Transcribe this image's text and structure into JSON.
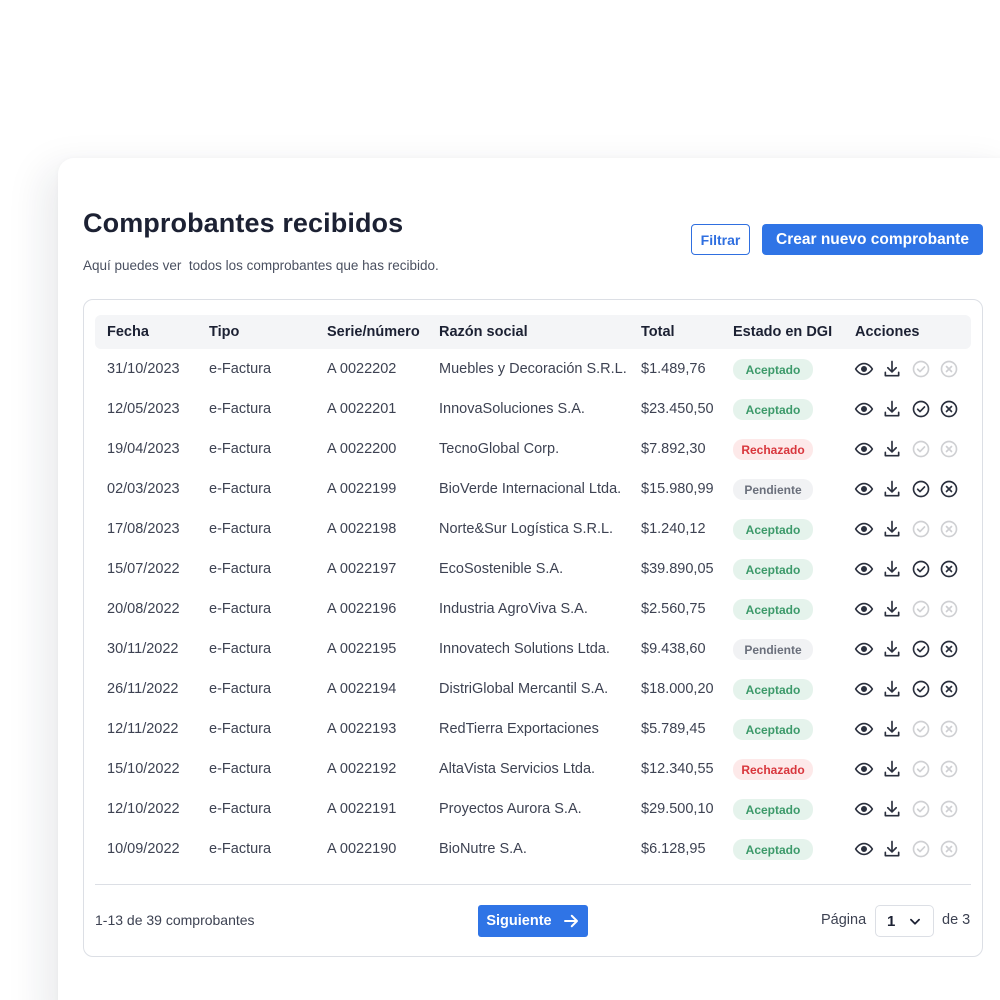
{
  "header": {
    "title": "Comprobantes recibidos",
    "subtitle": "Aquí puedes ver  todos los comprobantes que has recibido.",
    "filter_label": "Filtrar",
    "create_label": "Crear nuevo comprobante"
  },
  "table": {
    "columns": [
      "Fecha",
      "Tipo",
      "Serie/número",
      "Razón social",
      "Total",
      "Estado en DGI",
      "Acciones"
    ],
    "rows": [
      {
        "fecha": "31/10/2023",
        "tipo": "e-Factura",
        "serie": "A 0022202",
        "razon": "Muebles y Decoración S.R.L.",
        "total": "$1.489,76",
        "estado": "Aceptado",
        "estado_type": "ok",
        "actions_enabled": false
      },
      {
        "fecha": "12/05/2023",
        "tipo": "e-Factura",
        "serie": "A 0022201",
        "razon": "InnovaSoluciones S.A.",
        "total": "$23.450,50",
        "estado": "Aceptado",
        "estado_type": "ok",
        "actions_enabled": true
      },
      {
        "fecha": "19/04/2023",
        "tipo": "e-Factura",
        "serie": "A 0022200",
        "razon": "TecnoGlobal Corp.",
        "total": "$7.892,30",
        "estado": "Rechazado",
        "estado_type": "bad",
        "actions_enabled": false
      },
      {
        "fecha": "02/03/2023",
        "tipo": "e-Factura",
        "serie": "A 0022199",
        "razon": "BioVerde Internacional Ltda.",
        "total": "$15.980,99",
        "estado": "Pendiente",
        "estado_type": "pend",
        "actions_enabled": true
      },
      {
        "fecha": "17/08/2023",
        "tipo": "e-Factura",
        "serie": "A 0022198",
        "razon": "Norte&Sur Logística S.R.L.",
        "total": "$1.240,12",
        "estado": "Aceptado",
        "estado_type": "ok",
        "actions_enabled": false
      },
      {
        "fecha": "15/07/2022",
        "tipo": "e-Factura",
        "serie": "A 0022197",
        "razon": "EcoSostenible S.A.",
        "total": "$39.890,05",
        "estado": "Aceptado",
        "estado_type": "ok",
        "actions_enabled": true
      },
      {
        "fecha": "20/08/2022",
        "tipo": "e-Factura",
        "serie": "A 0022196",
        "razon": "Industria AgroViva S.A.",
        "total": "$2.560,75",
        "estado": "Aceptado",
        "estado_type": "ok",
        "actions_enabled": false
      },
      {
        "fecha": "30/11/2022",
        "tipo": "e-Factura",
        "serie": "A 0022195",
        "razon": "Innovatech Solutions Ltda.",
        "total": "$9.438,60",
        "estado": "Pendiente",
        "estado_type": "pend",
        "actions_enabled": true
      },
      {
        "fecha": "26/11/2022",
        "tipo": "e-Factura",
        "serie": "A 0022194",
        "razon": "DistriGlobal Mercantil S.A.",
        "total": "$18.000,20",
        "estado": "Aceptado",
        "estado_type": "ok",
        "actions_enabled": true
      },
      {
        "fecha": "12/11/2022",
        "tipo": "e-Factura",
        "serie": "A 0022193",
        "razon": "RedTierra Exportaciones",
        "total": "$5.789,45",
        "estado": "Aceptado",
        "estado_type": "ok",
        "actions_enabled": false
      },
      {
        "fecha": "15/10/2022",
        "tipo": "e-Factura",
        "serie": "A 0022192",
        "razon": "AltaVista Servicios Ltda.",
        "total": "$12.340,55",
        "estado": "Rechazado",
        "estado_type": "bad",
        "actions_enabled": false
      },
      {
        "fecha": "12/10/2022",
        "tipo": "e-Factura",
        "serie": "A 0022191",
        "razon": "Proyectos Aurora S.A.",
        "total": "$29.500,10",
        "estado": "Aceptado",
        "estado_type": "ok",
        "actions_enabled": false
      },
      {
        "fecha": "10/09/2022",
        "tipo": "e-Factura",
        "serie": "A 0022190",
        "razon": "BioNutre S.A.",
        "total": "$6.128,95",
        "estado": "Aceptado",
        "estado_type": "ok",
        "actions_enabled": false
      }
    ],
    "action_icons": [
      "eye-icon",
      "download-icon",
      "check-circle-icon",
      "x-circle-icon"
    ]
  },
  "footer": {
    "count_text": "1-13 de 39 comprobantes",
    "next_label": "Siguiente",
    "page_label": "Página",
    "page_value": "1",
    "page_total": "de 3"
  },
  "colors": {
    "accent": "#2f74e6",
    "accepted_bg": "#e5f3ec",
    "accepted_text": "#3c9a6a",
    "rejected_bg": "#fde9e9",
    "rejected_text": "#d8363c",
    "pending_bg": "#f1f2f4",
    "pending_text": "#6a6f7b"
  }
}
